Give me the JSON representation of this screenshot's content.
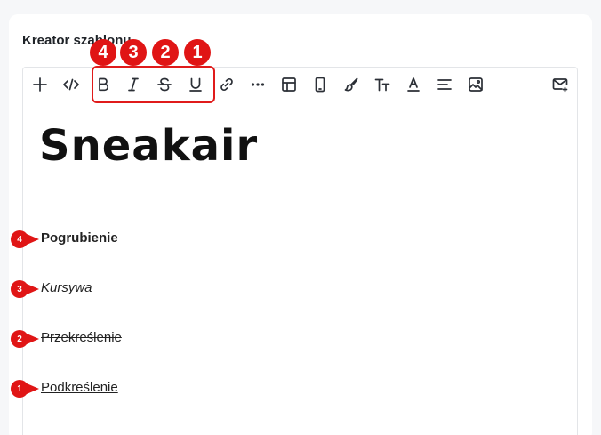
{
  "card": {
    "title": "Kreator szablonu"
  },
  "toolbar": {
    "buttons": [
      {
        "name": "add",
        "icon": "plus-icon"
      },
      {
        "name": "code",
        "icon": "code-icon"
      },
      {
        "name": "bold",
        "icon": "bold-icon"
      },
      {
        "name": "italic",
        "icon": "italic-icon"
      },
      {
        "name": "strikethrough",
        "icon": "strikethrough-icon"
      },
      {
        "name": "underline",
        "icon": "underline-icon"
      },
      {
        "name": "link",
        "icon": "link-icon"
      },
      {
        "name": "more",
        "icon": "more-icon"
      },
      {
        "name": "table",
        "icon": "table-icon"
      },
      {
        "name": "mobile",
        "icon": "mobile-icon"
      },
      {
        "name": "brush",
        "icon": "brush-icon"
      },
      {
        "name": "text-size",
        "icon": "text-size-icon"
      },
      {
        "name": "text-color",
        "icon": "text-color-icon"
      },
      {
        "name": "align",
        "icon": "align-left-icon"
      },
      {
        "name": "image",
        "icon": "image-icon"
      },
      {
        "name": "email",
        "icon": "email-icon"
      }
    ]
  },
  "annotations": {
    "badges": [
      "4",
      "3",
      "2",
      "1"
    ],
    "markers": [
      "4",
      "3",
      "2",
      "1"
    ]
  },
  "content": {
    "logo": "Sneakair",
    "bold": "Pogrubienie",
    "italic": "Kursywa",
    "strike": "Przekreślenie",
    "underline": "Podkreślenie"
  },
  "colors": {
    "accent": "#e01515",
    "text": "#1f2328",
    "border": "#e3e5e8"
  }
}
